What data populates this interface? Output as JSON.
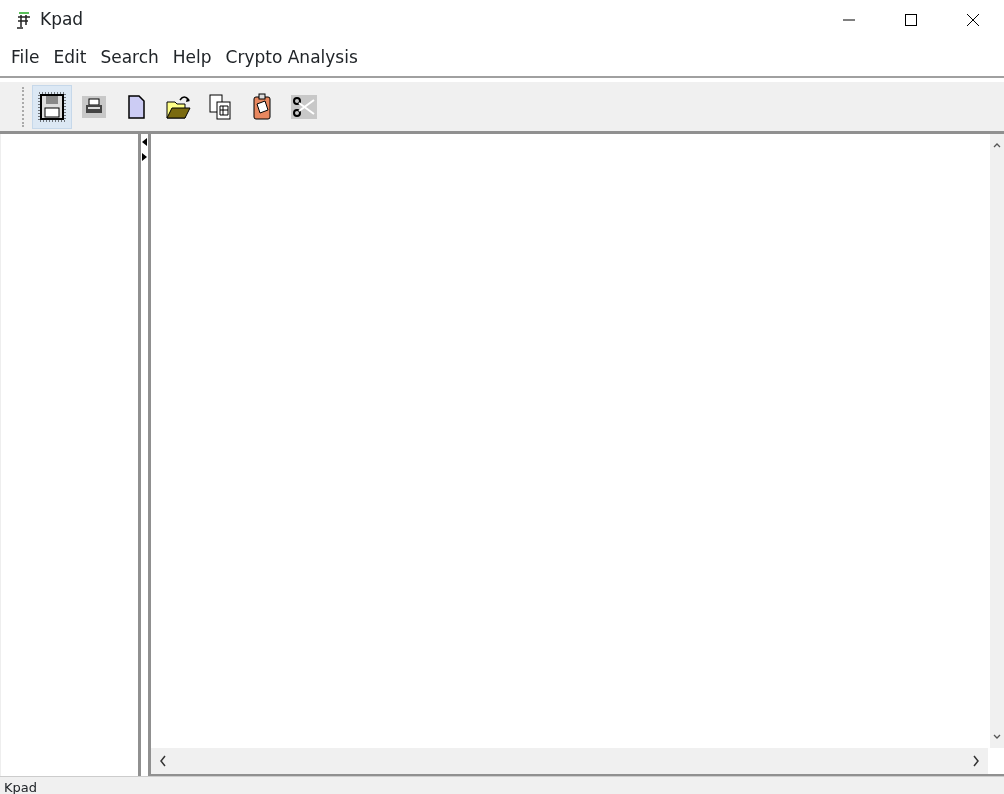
{
  "window": {
    "title": "Kpad"
  },
  "menu": [
    "File",
    "Edit",
    "Search",
    "Help",
    "Crypto Analysis"
  ],
  "toolbar": [
    {
      "kind": "save",
      "selected": true
    },
    {
      "kind": "print",
      "selected": false
    },
    {
      "kind": "new",
      "selected": false
    },
    {
      "kind": "open",
      "selected": false
    },
    {
      "kind": "copy",
      "selected": false
    },
    {
      "kind": "paste",
      "selected": false
    },
    {
      "kind": "cut",
      "selected": false
    }
  ],
  "status_bar": "Kpad"
}
